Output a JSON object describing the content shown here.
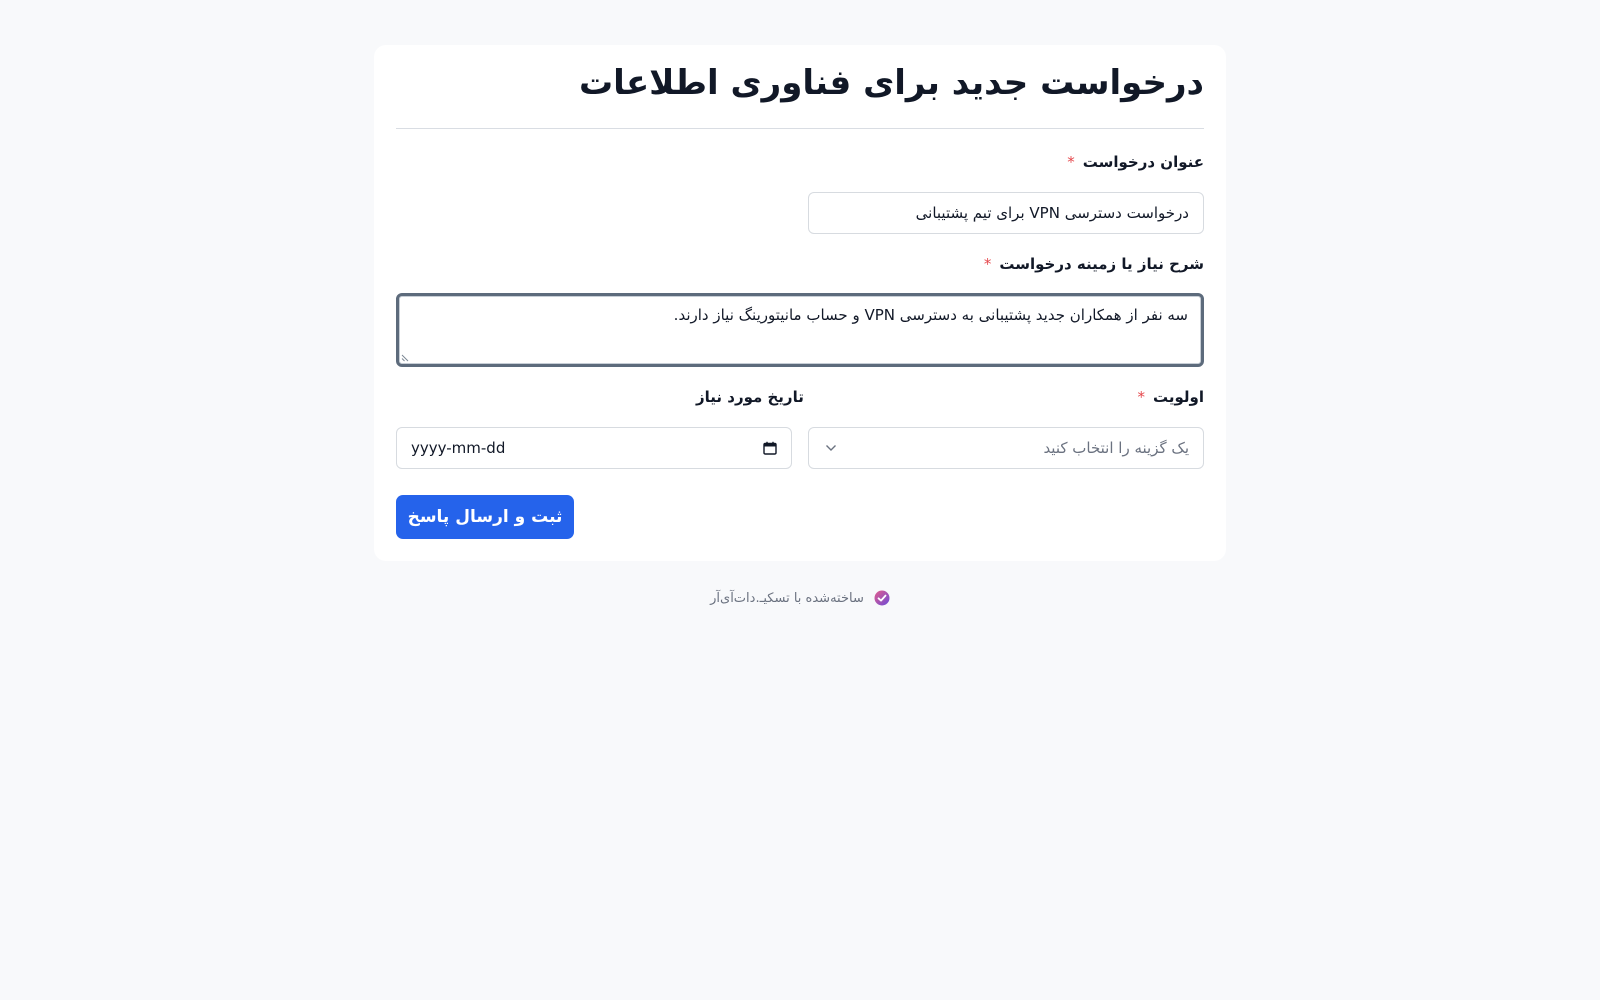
{
  "form": {
    "title": "درخواست جدید برای فناوری اطلاعات",
    "required_mark": "*",
    "fields": {
      "request_title": {
        "label": "عنوان درخواست",
        "value": "درخواست دسترسی VPN برای تیم پشتیبانی"
      },
      "description": {
        "label": "شرح نیاز یا زمینه درخواست",
        "value": "سه نفر از همکاران جدید پشتیبانی به دسترسی VPN و حساب مانیتورینگ نیاز دارند."
      },
      "priority": {
        "label": "اولویت",
        "placeholder": "یک گزینه را انتخاب کنید"
      },
      "due_date": {
        "label": "تاریخ مورد نیاز",
        "placeholder": "yyyy-mm-dd"
      }
    },
    "submit_label": "ثبت و ارسال پاسخ"
  },
  "footer": {
    "text": "ساخته‌شده با تسکیـ.دات‌آی‌آر"
  },
  "colors": {
    "accent": "#2563eb",
    "required": "#e5484d",
    "page_background": "#f8f9fb"
  }
}
